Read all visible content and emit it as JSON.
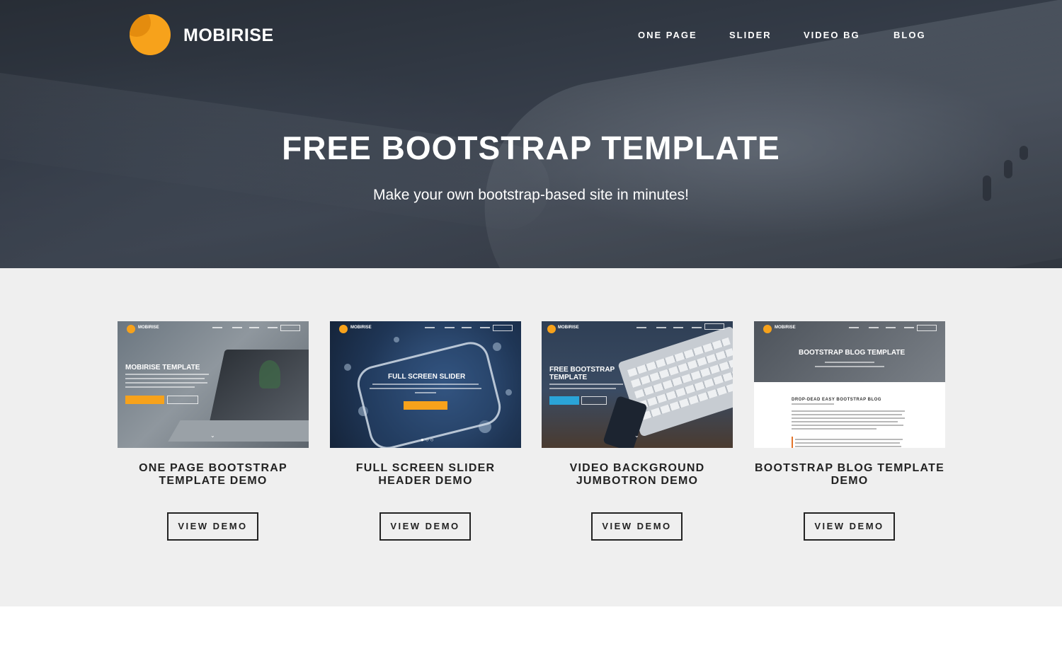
{
  "header": {
    "brand": "MOBIRISE",
    "nav": [
      "ONE PAGE",
      "SLIDER",
      "VIDEO BG",
      "BLOG"
    ]
  },
  "hero": {
    "title": "FREE BOOTSTRAP TEMPLATE",
    "subtitle": "Make your own bootstrap-based site in minutes!"
  },
  "cards": [
    {
      "title": "ONE PAGE BOOTSTRAP TEMPLATE DEMO",
      "button": "VIEW DEMO",
      "thumb": {
        "brand": "MOBIRISE",
        "heading": "MOBIRISE TEMPLATE"
      }
    },
    {
      "title": "FULL SCREEN SLIDER HEADER DEMO",
      "button": "VIEW DEMO",
      "thumb": {
        "brand": "MOBIRISE",
        "heading": "FULL SCREEN SLIDER"
      }
    },
    {
      "title": "VIDEO BACKGROUND JUMBOTRON DEMO",
      "button": "VIEW DEMO",
      "thumb": {
        "brand": "MOBIRISE",
        "heading": "FREE BOOTSTRAP TEMPLATE"
      }
    },
    {
      "title": "BOOTSTRAP BLOG TEMPLATE DEMO",
      "button": "VIEW DEMO",
      "thumb": {
        "brand": "MOBIRISE",
        "heading": "BOOTSTRAP BLOG TEMPLATE",
        "subheading": "DROP-DEAD EASY BOOTSTRAP BLOG"
      }
    }
  ],
  "colors": {
    "accent": "#f7a21b",
    "section_bg": "#efefef",
    "text_dark": "#232323",
    "hero_text": "#ffffff"
  }
}
